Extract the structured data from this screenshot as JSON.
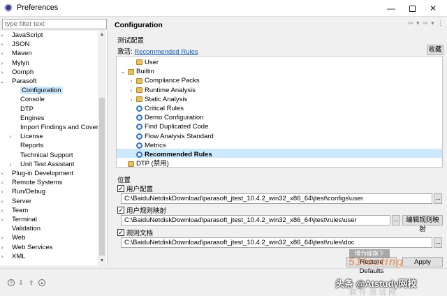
{
  "window": {
    "title": "Preferences",
    "minimize": "—",
    "close": "✕"
  },
  "filter": {
    "placeholder": "type filter text"
  },
  "left_tree": [
    {
      "label": "JavaScript",
      "twisty": "›",
      "level": 0
    },
    {
      "label": "JSON",
      "twisty": "›",
      "level": 0
    },
    {
      "label": "Maven",
      "twisty": "›",
      "level": 0
    },
    {
      "label": "Mylyn",
      "twisty": "›",
      "level": 0
    },
    {
      "label": "Oomph",
      "twisty": "›",
      "level": 0
    },
    {
      "label": "Parasoft",
      "twisty": "⌄",
      "level": 0
    },
    {
      "label": "Configuration",
      "twisty": "",
      "level": 1,
      "selected": true
    },
    {
      "label": "Console",
      "twisty": "",
      "level": 1
    },
    {
      "label": "DTP",
      "twisty": "",
      "level": 1
    },
    {
      "label": "Engines",
      "twisty": "",
      "level": 1
    },
    {
      "label": "Import Findings and Cover",
      "twisty": "",
      "level": 1
    },
    {
      "label": "License",
      "twisty": "›",
      "level": 1
    },
    {
      "label": "Reports",
      "twisty": "",
      "level": 1
    },
    {
      "label": "Technical Support",
      "twisty": "",
      "level": 1
    },
    {
      "label": "Unit Test Assistant",
      "twisty": "›",
      "level": 1
    },
    {
      "label": "Plug-in Development",
      "twisty": "›",
      "level": 0
    },
    {
      "label": "Remote Systems",
      "twisty": "›",
      "level": 0
    },
    {
      "label": "Run/Debug",
      "twisty": "›",
      "level": 0
    },
    {
      "label": "Server",
      "twisty": "›",
      "level": 0
    },
    {
      "label": "Team",
      "twisty": "›",
      "level": 0
    },
    {
      "label": "Terminal",
      "twisty": "›",
      "level": 0
    },
    {
      "label": "Validation",
      "twisty": "",
      "level": 0
    },
    {
      "label": "Web",
      "twisty": "›",
      "level": 0
    },
    {
      "label": "Web Services",
      "twisty": "›",
      "level": 0
    },
    {
      "label": "XML",
      "twisty": "›",
      "level": 0
    }
  ],
  "panel": {
    "title": "Configuration",
    "nav_arrows": "⇦ ▾ ⇨ ▾ ⋮",
    "test_config_label": "测试配置",
    "activate_label": "激活:",
    "activate_link": "Recommended Rules",
    "collapse_button": "收藏"
  },
  "config_tree": [
    {
      "label": "User",
      "twisty": "",
      "level": 1,
      "icon": "folder"
    },
    {
      "label": "Builtin",
      "twisty": "⌄",
      "level": 0,
      "icon": "folder"
    },
    {
      "label": "Compliance Packs",
      "twisty": "›",
      "level": 1,
      "icon": "folder"
    },
    {
      "label": "Runtime Analysis",
      "twisty": "›",
      "level": 1,
      "icon": "folder"
    },
    {
      "label": "Static Analysis",
      "twisty": "›",
      "level": 1,
      "icon": "folder"
    },
    {
      "label": "Critical Rules",
      "twisty": "",
      "level": 1,
      "icon": "rule"
    },
    {
      "label": "Demo Configuration",
      "twisty": "",
      "level": 1,
      "icon": "rule"
    },
    {
      "label": "Find Duplicated Code",
      "twisty": "",
      "level": 1,
      "icon": "rule"
    },
    {
      "label": "Flow Analysis Standard",
      "twisty": "",
      "level": 1,
      "icon": "rule"
    },
    {
      "label": "Metrics",
      "twisty": "",
      "level": 1,
      "icon": "rule"
    },
    {
      "label": "Recommended Rules",
      "twisty": "",
      "level": 1,
      "icon": "rule",
      "selected": true
    },
    {
      "label": "DTP (禁用)",
      "twisty": "",
      "level": 0,
      "icon": "folder"
    }
  ],
  "locations": {
    "label": "位置",
    "items": [
      {
        "checked": true,
        "label": "用户配置",
        "path": "C:\\BaiduNetdiskDownload\\parasoft_jtest_10.4.2_win32_x86_64\\jtest\\configs\\user",
        "browse": "...",
        "extra": ""
      },
      {
        "checked": true,
        "label": "用户规则映射",
        "path": "C:\\BaiduNetdiskDownload\\parasoft_jtest_10.4.2_win32_x86_64\\jtest\\rules\\user",
        "browse": "...",
        "extra": "编辑规则映射"
      },
      {
        "checked": true,
        "label": "规则文档",
        "path": "C:\\BaiduNetdiskDownload\\parasoft_jtest_10.4.2_win32_x86_64\\jtest\\rules\\doc",
        "browse": "...",
        "extra": ""
      }
    ]
  },
  "buttons": {
    "restore_defaults": "Restore Defaults",
    "apply": "Apply"
  },
  "bottom_icons": [
    "help-icon",
    "import-icon",
    "export-icon",
    "preferences-icon"
  ],
  "watermark": {
    "badge": "博为峰旗下",
    "logo": "51testing",
    "caption": "头条 @Atstudy网校",
    "footer": "软件测试网"
  },
  "colors": {
    "selection": "#cce8ff",
    "link": "#1a5fb4",
    "rule_icon": "#3a73c4"
  }
}
